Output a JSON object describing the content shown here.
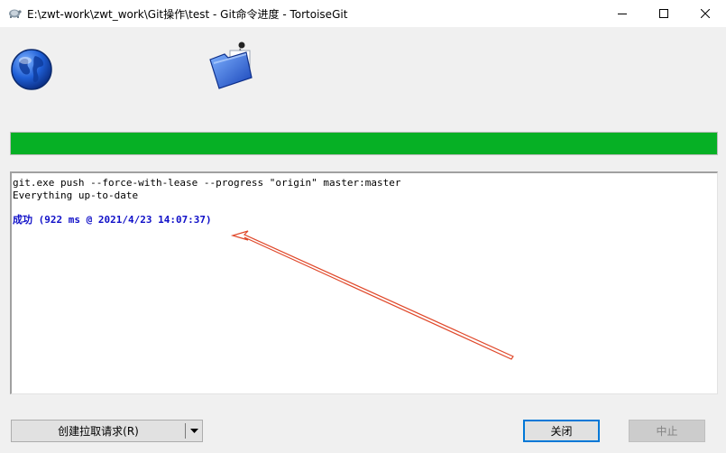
{
  "window": {
    "title": "E:\\zwt-work\\zwt_work\\Git操作\\test - Git命令进度 - TortoiseGit",
    "controls": {
      "minimize": "minimize-icon",
      "maximize": "maximize-icon",
      "close": "close-icon"
    }
  },
  "progress": {
    "value": 1.0,
    "color": "#06b025"
  },
  "log": {
    "lines": [
      {
        "text": "git.exe push --force-with-lease --progress \"origin\" master:master",
        "type": "normal"
      },
      {
        "text": "Everything up-to-date",
        "type": "normal"
      },
      {
        "text": "",
        "type": "blank"
      },
      {
        "text": "成功 (922 ms @ 2021/4/23 14:07:37)",
        "type": "success"
      }
    ],
    "success_color": "#1010c8"
  },
  "annotation": {
    "arrow_color": "#e0482a"
  },
  "buttons": {
    "create_pull_request": "创建拉取请求(R)",
    "close": "关闭",
    "abort": "中止"
  }
}
